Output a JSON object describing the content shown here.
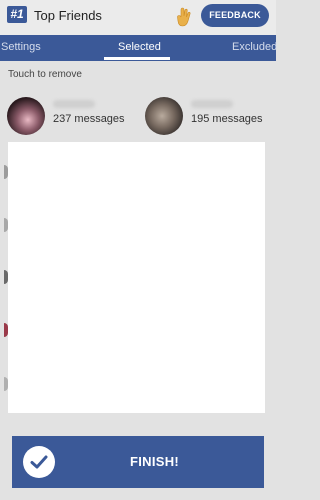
{
  "header": {
    "logo_text": "#1",
    "title": "Top Friends",
    "feedback_label": "FEEDBACK"
  },
  "tabs": [
    {
      "label": "Settings",
      "selected": false
    },
    {
      "label": "Selected",
      "selected": true
    },
    {
      "label": "Excluded",
      "selected": false
    }
  ],
  "hint": "Touch to remove",
  "friends": [
    {
      "count_text": "237 messages"
    },
    {
      "count_text": "195 messages"
    }
  ],
  "finish": {
    "label": "FINISH!"
  },
  "colors": {
    "brand": "#3b5998",
    "background": "#e2e2e2",
    "panel": "#ffffff"
  },
  "icons": [
    "hand-icon",
    "check-icon"
  ]
}
